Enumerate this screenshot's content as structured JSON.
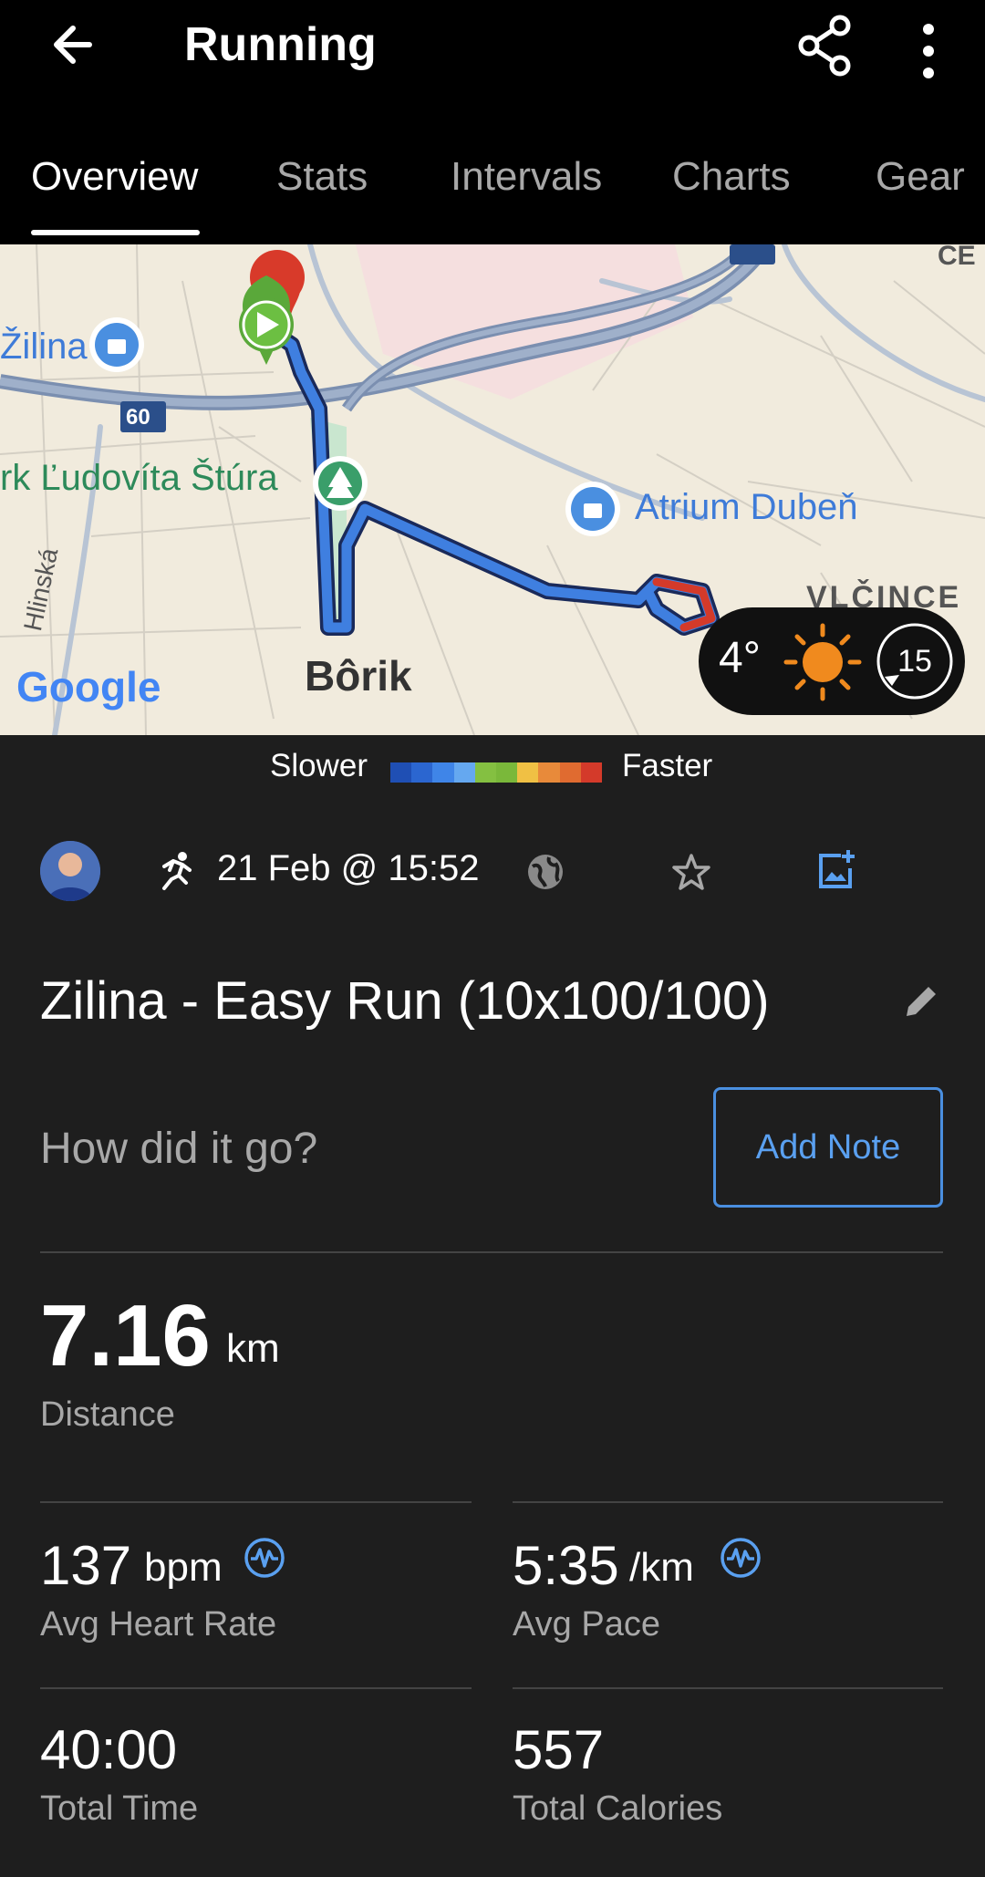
{
  "header": {
    "title": "Running"
  },
  "tabs": [
    {
      "label": "Overview",
      "active": true
    },
    {
      "label": "Stats"
    },
    {
      "label": "Intervals"
    },
    {
      "label": "Charts"
    },
    {
      "label": "Gear"
    }
  ],
  "map": {
    "labels": {
      "zilina": "Žilina",
      "park": "rk Ľudovíta Štúra",
      "atrium": "Atrium Dubeň",
      "borik": "Bôrik",
      "vlcince": "VLČINCE",
      "road60": "60",
      "ce": "CE",
      "street": "Hlinská",
      "google": "Google"
    },
    "weather": {
      "temperature": "4°",
      "wind": "15",
      "icon": "sun-icon"
    }
  },
  "legend": {
    "slower": "Slower",
    "faster": "Faster",
    "colors": [
      "#1f4fb4",
      "#2b66d0",
      "#3f85e8",
      "#65a8f0",
      "#84c041",
      "#7ab83a",
      "#f0c044",
      "#e88a3a",
      "#e06b30",
      "#d43a2a"
    ]
  },
  "meta": {
    "date": "21 Feb @ 15:52",
    "activity_icon": "running-icon",
    "privacy_icon": "globe-icon",
    "favorite_icon": "star-icon",
    "photo_icon": "add-photo-icon"
  },
  "activity": {
    "title": "Zilina - Easy Run (10x100/100)"
  },
  "note": {
    "prompt": "How did it go?",
    "button": "Add Note"
  },
  "distance": {
    "value": "7.16",
    "unit": "km",
    "label": "Distance"
  },
  "stats": {
    "heart_rate": {
      "value": "137",
      "unit": "bpm",
      "label": "Avg Heart Rate"
    },
    "pace": {
      "value": "5:35",
      "unit": "/km",
      "label": "Avg Pace"
    },
    "time": {
      "value": "40:00",
      "label": "Total Time"
    },
    "calories": {
      "value": "557",
      "label": "Total Calories"
    }
  },
  "colors": {
    "accent": "#4a8fe0",
    "background": "#1e1e1e",
    "header": "#000000"
  }
}
